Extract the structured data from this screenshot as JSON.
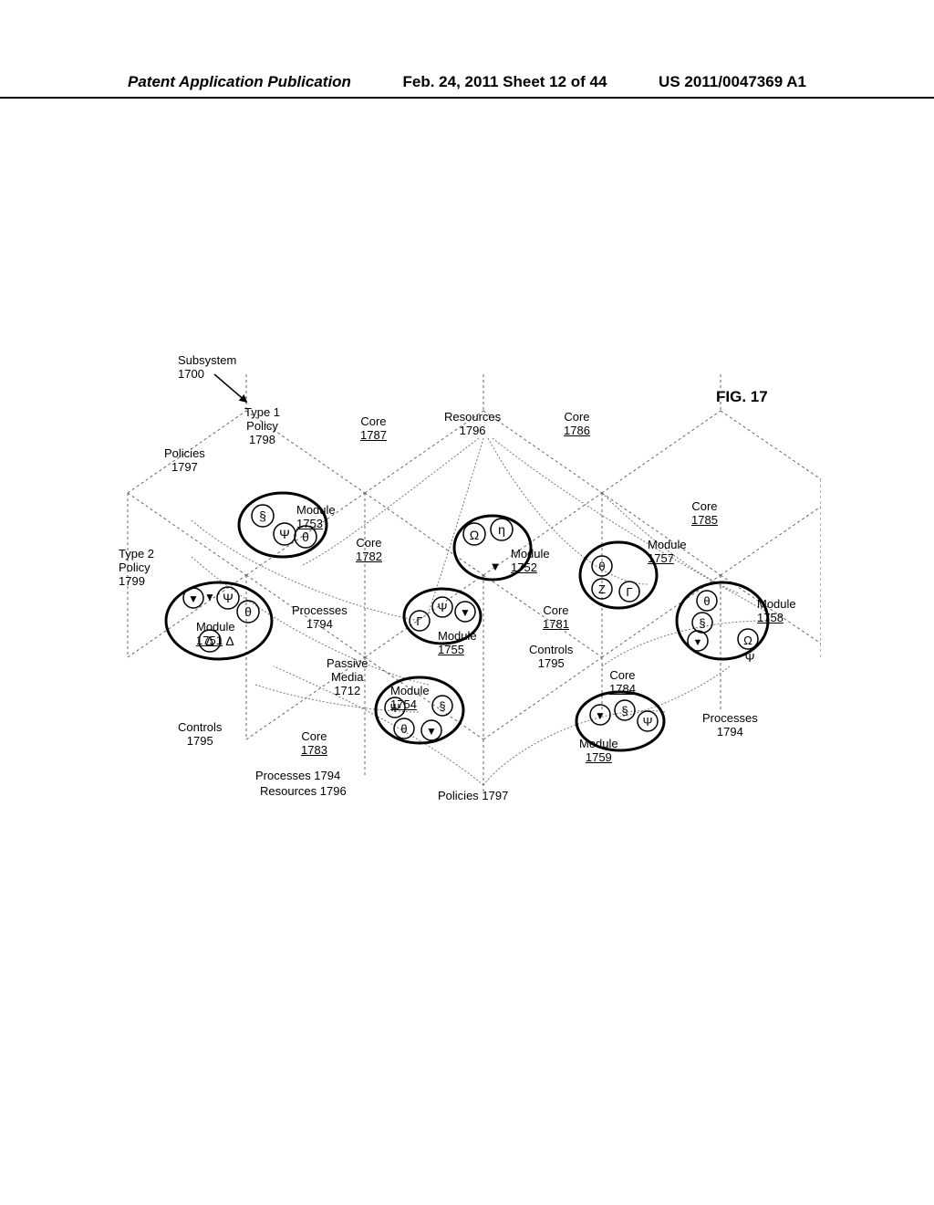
{
  "header": {
    "left": "Patent Application Publication",
    "center": "Feb. 24, 2011  Sheet 12 of 44",
    "right": "US 2011/0047369 A1"
  },
  "figure": {
    "label": "FIG. 17"
  },
  "labels": {
    "subsystem": "Subsystem\n1700",
    "type1": "Type 1\nPolicy\n1798",
    "core1787": "Core",
    "core1787n": "1787",
    "resources1796": "Resources\n1796",
    "core1786": "Core",
    "core1786n": "1786",
    "policies1797": "Policies\n1797",
    "core1785": "Core",
    "core1785n": "1785",
    "type2": "Type 2\nPolicy\n1799",
    "module1753": "Module",
    "module1753n": "1753",
    "core1782": "Core",
    "core1782n": "1782",
    "module1752": "Module",
    "module1752n": "1752",
    "module1757": "Module",
    "module1757n": "1757",
    "module1751": "Module",
    "module1751n": "1751",
    "processes1794": "Processes\n1794",
    "module1755": "Module",
    "module1755n": "1755",
    "core1781": "Core",
    "core1781n": "1781",
    "module1758": "Module",
    "module1758n": "1758",
    "passive": "Passive\nMedia\n1712",
    "module1754": "Module",
    "module1754n": "1754",
    "controls1795": "Controls\n1795",
    "core1784": "Core",
    "core1784n": "1784",
    "controls1795b": "Controls\n1795",
    "core1783": "Core",
    "core1783n": "1783",
    "module1759": "Module",
    "module1759n": "1759",
    "processes1794b": "Processes\n1794",
    "processes1794c": "Processes 1794",
    "resources1796b": "Resources 1796",
    "policies1797b": "Policies 1797"
  },
  "glyphs": {
    "psi": "Ψ",
    "theta": "θ",
    "section": "§",
    "eta": "η",
    "omega": "Ω",
    "zeta": "Ζ",
    "gammaU": "Γ",
    "delta": "Δ",
    "tri": "▼"
  }
}
